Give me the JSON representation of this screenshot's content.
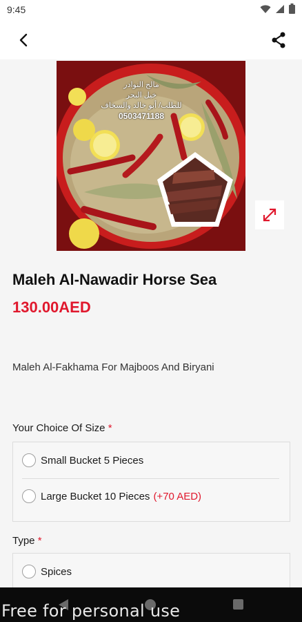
{
  "status_bar": {
    "time": "9:45"
  },
  "product": {
    "image_overlay_text": [
      "مالح النوادر",
      "خيل البحر",
      "للطلب/ أبو خالد والسخاف",
      "0503471188"
    ],
    "title": "Maleh Al-Nawadir Horse Sea",
    "price": "130.00AED",
    "description": "Maleh Al-Fakhama For Majboos And Biryani"
  },
  "size_section": {
    "label": "Your Choice Of Size",
    "required_mark": "*",
    "options": [
      {
        "label": "Small Bucket 5 Pieces",
        "extra": ""
      },
      {
        "label": "Large Bucket 10 Pieces",
        "extra": "(+70 AED)"
      }
    ]
  },
  "type_section": {
    "label": "Type",
    "required_mark": "*",
    "options": [
      {
        "label": "Spices"
      }
    ]
  },
  "footer": {
    "watermark": "Free for personal use"
  },
  "colors": {
    "accent": "#e0182d",
    "background": "#f5f5f5",
    "nav_bar": "#0b0b0b"
  },
  "icons": {
    "back": "back-arrow-icon",
    "share": "share-icon",
    "expand": "expand-icon",
    "wifi": "wifi-icon",
    "signal": "signal-icon",
    "battery": "battery-icon"
  }
}
